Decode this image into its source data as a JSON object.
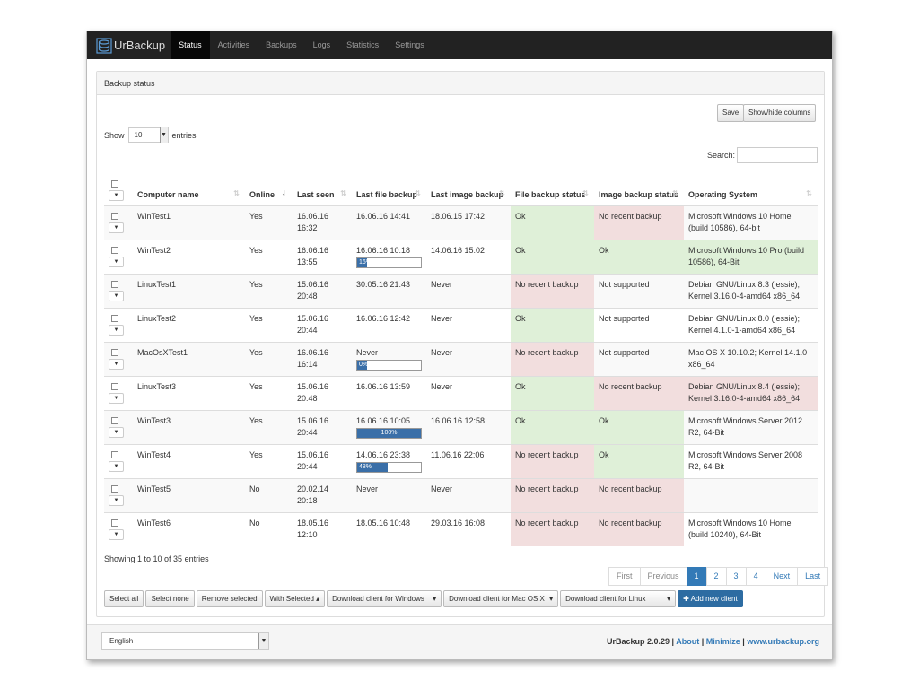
{
  "app": {
    "brand": "UrBackup",
    "nav": [
      "Status",
      "Activities",
      "Backups",
      "Logs",
      "Statistics",
      "Settings"
    ],
    "active_nav": "Status"
  },
  "panel": {
    "title": "Backup status",
    "save_label": "Save",
    "showhide_label": "Show/hide columns",
    "show_label": "Show",
    "entries_value": "10",
    "entries_label": "entries",
    "search_label": "Search:"
  },
  "table": {
    "headers": [
      "Computer name",
      "Online",
      "Last seen",
      "Last file backup",
      "Last image backup",
      "File backup status",
      "Image backup status",
      "Operating System"
    ],
    "rows": [
      {
        "name": "WinTest1",
        "online": "Yes",
        "last_seen": "16.06.16 16:32",
        "last_file": "16.06.16 14:41",
        "progress": null,
        "last_image": "18.06.15 17:42",
        "file_status": "Ok",
        "file_ok": true,
        "image_status": "No recent backup",
        "image_ok": false,
        "os": "Microsoft Windows 10 Home (build 10586), 64-bit",
        "os_ok": null
      },
      {
        "name": "WinTest2",
        "online": "Yes",
        "last_seen": "16.06.16 13:55",
        "last_file": "16.06.16 10:18",
        "progress": 16,
        "progress_label": "16%",
        "last_image": "14.06.16 15:02",
        "file_status": "Ok",
        "file_ok": true,
        "image_status": "Ok",
        "image_ok": true,
        "os": "Microsoft Windows 10 Pro (build 10586), 64-Bit",
        "os_ok": true
      },
      {
        "name": "LinuxTest1",
        "online": "Yes",
        "last_seen": "15.06.16 20:48",
        "last_file": "30.05.16 21:43",
        "progress": null,
        "last_image": "Never",
        "file_status": "No recent backup",
        "file_ok": false,
        "image_status": "Not supported",
        "image_ok": null,
        "os": "Debian GNU/Linux 8.3 (jessie); Kernel 3.16.0-4-amd64 x86_64",
        "os_ok": null
      },
      {
        "name": "LinuxTest2",
        "online": "Yes",
        "last_seen": "15.06.16 20:44",
        "last_file": "16.06.16 12:42",
        "progress": null,
        "last_image": "Never",
        "file_status": "Ok",
        "file_ok": true,
        "image_status": "Not supported",
        "image_ok": null,
        "os": "Debian GNU/Linux 8.0 (jessie); Kernel 4.1.0-1-amd64 x86_64",
        "os_ok": null
      },
      {
        "name": "MacOsXTest1",
        "online": "Yes",
        "last_seen": "16.06.16 16:14",
        "last_file": "Never",
        "progress": 0,
        "progress_label": "0%",
        "last_image": "Never",
        "file_status": "No recent backup",
        "file_ok": false,
        "image_status": "Not supported",
        "image_ok": null,
        "os": "Mac OS X 10.10.2; Kernel 14.1.0 x86_64",
        "os_ok": null
      },
      {
        "name": "LinuxTest3",
        "online": "Yes",
        "last_seen": "15.06.16 20:48",
        "last_file": "16.06.16 13:59",
        "progress": null,
        "last_image": "Never",
        "file_status": "Ok",
        "file_ok": true,
        "image_status": "No recent backup",
        "image_ok": false,
        "os": "Debian GNU/Linux 8.4 (jessie); Kernel 3.16.0-4-amd64 x86_64",
        "os_ok": false
      },
      {
        "name": "WinTest3",
        "online": "Yes",
        "last_seen": "15.06.16 20:44",
        "last_file": "16.06.16 10:05",
        "progress": 100,
        "progress_label": "100%",
        "last_image": "16.06.16 12:58",
        "file_status": "Ok",
        "file_ok": true,
        "image_status": "Ok",
        "image_ok": true,
        "os": "Microsoft Windows Server 2012 R2, 64-Bit",
        "os_ok": null
      },
      {
        "name": "WinTest4",
        "online": "Yes",
        "last_seen": "15.06.16 20:44",
        "last_file": "14.06.16 23:38",
        "progress": 48,
        "progress_label": "48%",
        "last_image": "11.06.16 22:06",
        "file_status": "No recent backup",
        "file_ok": false,
        "image_status": "Ok",
        "image_ok": true,
        "os": "Microsoft Windows Server 2008 R2, 64-Bit",
        "os_ok": null
      },
      {
        "name": "WinTest5",
        "online": "No",
        "last_seen": "20.02.14 20:18",
        "last_file": "Never",
        "progress": null,
        "last_image": "Never",
        "file_status": "No recent backup",
        "file_ok": false,
        "image_status": "No recent backup",
        "image_ok": false,
        "os": "",
        "os_ok": null
      },
      {
        "name": "WinTest6",
        "online": "No",
        "last_seen": "18.05.16 12:10",
        "last_file": "18.05.16 10:48",
        "progress": null,
        "last_image": "29.03.16 16:08",
        "file_status": "No recent backup",
        "file_ok": false,
        "image_status": "No recent backup",
        "image_ok": false,
        "os": "Microsoft Windows 10 Home (build 10240), 64-Bit",
        "os_ok": null
      }
    ]
  },
  "showing": "Showing 1 to 10 of 35 entries",
  "pagination": [
    "First",
    "Previous",
    "1",
    "2",
    "3",
    "4",
    "Next",
    "Last"
  ],
  "active_page": "1",
  "actions": {
    "select_all": "Select all",
    "select_none": "Select none",
    "remove_selected": "Remove selected",
    "with_selected": "With Selected",
    "dl_windows": "Download client for Windows",
    "dl_mac": "Download client for Mac OS X",
    "dl_linux": "Download client for Linux",
    "add_client": "Add new client"
  },
  "footer": {
    "language": "English",
    "version": "UrBackup 2.0.29",
    "links": [
      "About",
      "Minimize",
      "www.urbackup.org"
    ]
  },
  "colors": {
    "ok": "#dff0d8",
    "bad": "#f2dede",
    "accent": "#337ab7",
    "navbar": "#222222"
  }
}
